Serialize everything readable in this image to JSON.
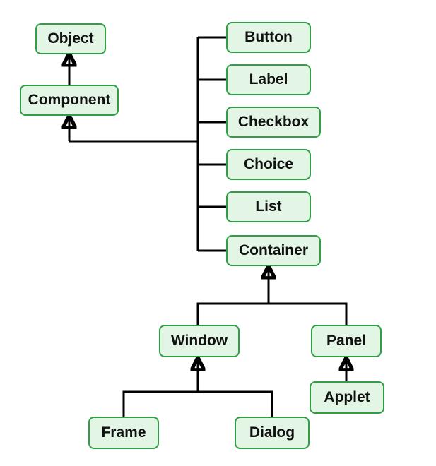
{
  "diagram": {
    "type": "class-hierarchy",
    "description": "Java AWT component inheritance hierarchy",
    "nodes": {
      "object": {
        "label": "Object"
      },
      "component": {
        "label": "Component"
      },
      "button": {
        "label": "Button"
      },
      "label": {
        "label": "Label"
      },
      "checkbox": {
        "label": "Checkbox"
      },
      "choice": {
        "label": "Choice"
      },
      "list": {
        "label": "List"
      },
      "container": {
        "label": "Container"
      },
      "window": {
        "label": "Window"
      },
      "panel": {
        "label": "Panel"
      },
      "frame": {
        "label": "Frame"
      },
      "dialog": {
        "label": "Dialog"
      },
      "applet": {
        "label": "Applet"
      }
    },
    "edges": [
      {
        "from": "component",
        "to": "object"
      },
      {
        "from": "button",
        "to": "component"
      },
      {
        "from": "label",
        "to": "component"
      },
      {
        "from": "checkbox",
        "to": "component"
      },
      {
        "from": "choice",
        "to": "component"
      },
      {
        "from": "list",
        "to": "component"
      },
      {
        "from": "container",
        "to": "component"
      },
      {
        "from": "window",
        "to": "container"
      },
      {
        "from": "panel",
        "to": "container"
      },
      {
        "from": "frame",
        "to": "window"
      },
      {
        "from": "dialog",
        "to": "window"
      },
      {
        "from": "applet",
        "to": "panel"
      }
    ],
    "colors": {
      "node_fill": "#e3f6e6",
      "node_border": "#2f9e44",
      "edge": "#000000"
    }
  }
}
